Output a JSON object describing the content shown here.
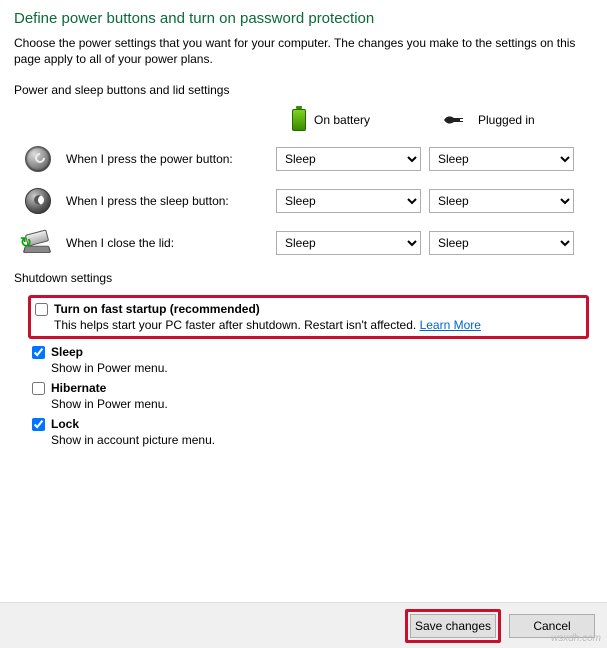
{
  "title": "Define power buttons and turn on password protection",
  "subtitle": "Choose the power settings that you want for your computer. The changes you make to the settings on this page apply to all of your power plans.",
  "section_header": "Power and sleep buttons and lid settings",
  "columns": {
    "battery": "On battery",
    "plugged": "Plugged in"
  },
  "rows": {
    "power": {
      "label": "When I press the power button:",
      "battery": "Sleep",
      "plugged": "Sleep"
    },
    "sleep": {
      "label": "When I press the sleep button:",
      "battery": "Sleep",
      "plugged": "Sleep"
    },
    "lid": {
      "label": "When I close the lid:",
      "battery": "Sleep",
      "plugged": "Sleep"
    }
  },
  "shutdown_header": "Shutdown settings",
  "fast_startup": {
    "checked": false,
    "label": "Turn on fast startup (recommended)",
    "desc": "This helps start your PC faster after shutdown. Restart isn't affected. ",
    "link": "Learn More"
  },
  "sleep_chk": {
    "checked": true,
    "label": "Sleep",
    "desc": "Show in Power menu."
  },
  "hibernate_chk": {
    "checked": false,
    "label": "Hibernate",
    "desc": "Show in Power menu."
  },
  "lock_chk": {
    "checked": true,
    "label": "Lock",
    "desc": "Show in account picture menu."
  },
  "buttons": {
    "save": "Save changes",
    "cancel": "Cancel"
  },
  "watermark": "wsxdh.com"
}
